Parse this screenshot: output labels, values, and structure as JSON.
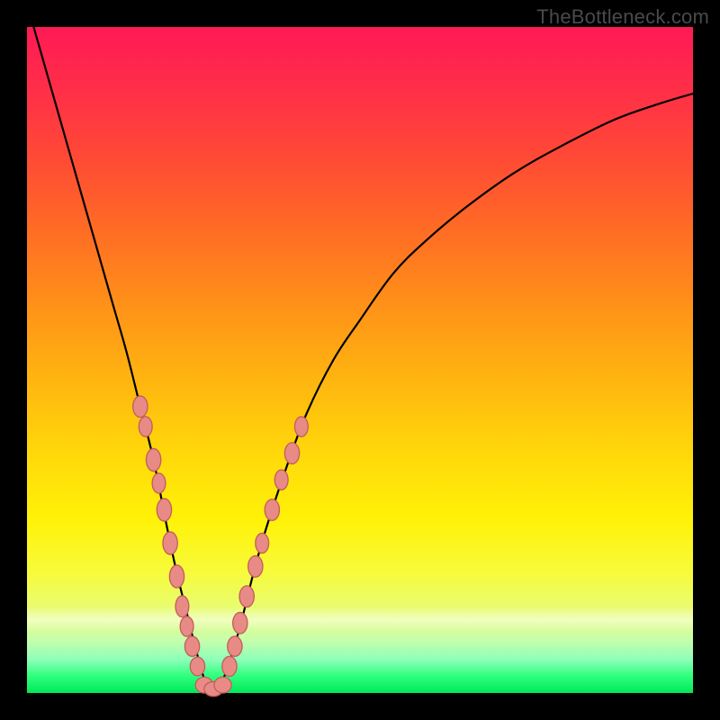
{
  "watermark": "TheBottleneck.com",
  "colors": {
    "curve_stroke": "#000000",
    "curve_width": 2.2,
    "marker_fill": "#e88b86",
    "marker_stroke": "#c35e5b"
  },
  "chart_data": {
    "type": "line",
    "title": "",
    "xlabel": "",
    "ylabel": "",
    "xlim": [
      0,
      100
    ],
    "ylim": [
      0,
      100
    ],
    "notes": "V-shaped bottleneck curve on red→green vertical gradient. Minimum near x≈27, y≈0. Axes unlabeled; values are positions read off the plot area as percentages.",
    "series": [
      {
        "name": "curve",
        "x": [
          1,
          3,
          5,
          7,
          9,
          11,
          13,
          15,
          17,
          19,
          21,
          22.5,
          24,
          25.5,
          27,
          28,
          29,
          30.5,
          32,
          34,
          36,
          39,
          42,
          46,
          50,
          55,
          60,
          66,
          73,
          80,
          88,
          95,
          100
        ],
        "y": [
          100,
          93,
          86,
          79,
          72,
          65,
          58,
          51,
          43,
          35,
          25,
          18,
          12,
          6,
          1,
          0.5,
          1,
          5,
          10,
          18,
          25,
          34,
          42,
          50,
          56,
          63,
          68,
          73,
          78,
          82,
          86,
          88.5,
          90
        ]
      }
    ],
    "markers": [
      {
        "x": 17.0,
        "y": 43.0,
        "rx": 1.1,
        "ry": 1.6
      },
      {
        "x": 17.8,
        "y": 40.0,
        "rx": 1.0,
        "ry": 1.5
      },
      {
        "x": 19.0,
        "y": 35.0,
        "rx": 1.1,
        "ry": 1.7
      },
      {
        "x": 19.8,
        "y": 31.5,
        "rx": 1.0,
        "ry": 1.5
      },
      {
        "x": 20.6,
        "y": 27.5,
        "rx": 1.1,
        "ry": 1.7
      },
      {
        "x": 21.5,
        "y": 22.5,
        "rx": 1.1,
        "ry": 1.7
      },
      {
        "x": 22.5,
        "y": 17.5,
        "rx": 1.1,
        "ry": 1.7
      },
      {
        "x": 23.3,
        "y": 13.0,
        "rx": 1.0,
        "ry": 1.6
      },
      {
        "x": 24.0,
        "y": 10.0,
        "rx": 1.0,
        "ry": 1.5
      },
      {
        "x": 24.8,
        "y": 7.0,
        "rx": 1.1,
        "ry": 1.5
      },
      {
        "x": 25.6,
        "y": 4.0,
        "rx": 1.1,
        "ry": 1.4
      },
      {
        "x": 26.6,
        "y": 1.2,
        "rx": 1.3,
        "ry": 1.2
      },
      {
        "x": 28.0,
        "y": 0.6,
        "rx": 1.4,
        "ry": 1.1
      },
      {
        "x": 29.4,
        "y": 1.2,
        "rx": 1.3,
        "ry": 1.2
      },
      {
        "x": 30.4,
        "y": 4.0,
        "rx": 1.1,
        "ry": 1.5
      },
      {
        "x": 31.2,
        "y": 7.0,
        "rx": 1.1,
        "ry": 1.5
      },
      {
        "x": 32.0,
        "y": 10.5,
        "rx": 1.1,
        "ry": 1.6
      },
      {
        "x": 33.0,
        "y": 14.5,
        "rx": 1.1,
        "ry": 1.6
      },
      {
        "x": 34.3,
        "y": 19.0,
        "rx": 1.1,
        "ry": 1.6
      },
      {
        "x": 35.3,
        "y": 22.5,
        "rx": 1.0,
        "ry": 1.5
      },
      {
        "x": 36.8,
        "y": 27.5,
        "rx": 1.1,
        "ry": 1.6
      },
      {
        "x": 38.2,
        "y": 32.0,
        "rx": 1.0,
        "ry": 1.5
      },
      {
        "x": 39.8,
        "y": 36.0,
        "rx": 1.1,
        "ry": 1.6
      },
      {
        "x": 41.2,
        "y": 40.0,
        "rx": 1.0,
        "ry": 1.5
      }
    ]
  }
}
